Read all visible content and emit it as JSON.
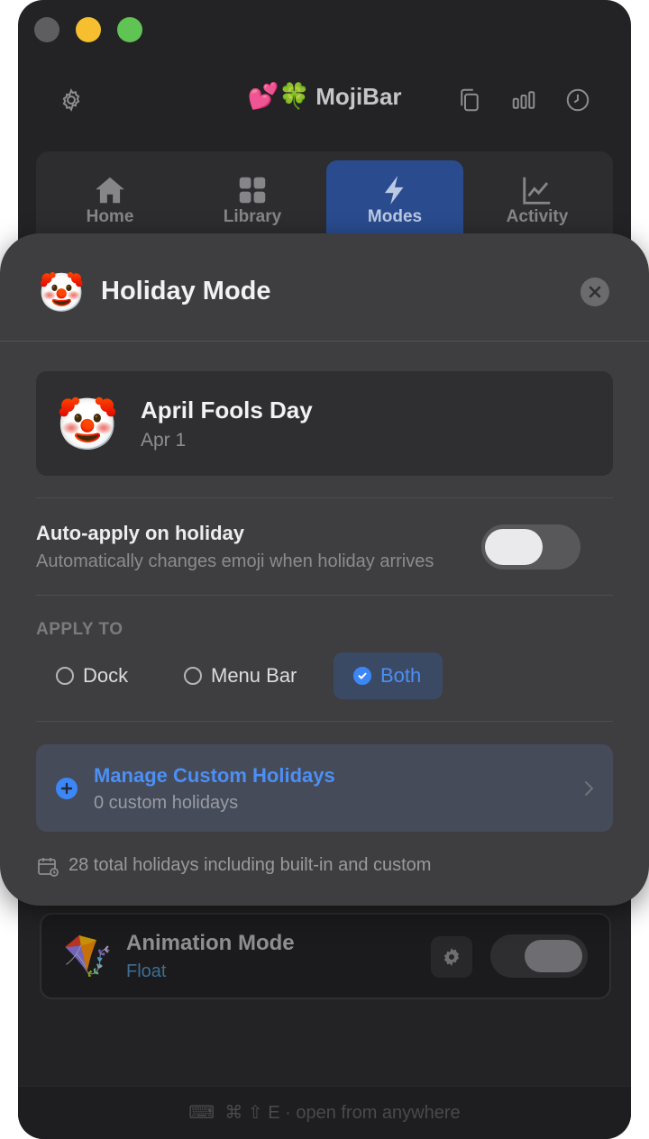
{
  "app": {
    "title": "MojiBar",
    "title_emojis": "💕🍀"
  },
  "tabs": [
    {
      "label": "Home",
      "icon": "home-icon",
      "active": false
    },
    {
      "label": "Library",
      "icon": "grid-icon",
      "active": false
    },
    {
      "label": "Modes",
      "icon": "bolt-icon",
      "active": true
    },
    {
      "label": "Activity",
      "icon": "chart-icon",
      "active": false
    }
  ],
  "modal": {
    "title": "Holiday Mode",
    "title_emoji": "🤡",
    "holiday": {
      "emoji": "🤡",
      "name": "April Fools Day",
      "date": "Apr 1"
    },
    "auto_apply": {
      "title": "Auto-apply on holiday",
      "subtitle": "Automatically changes emoji when holiday arrives",
      "enabled": false
    },
    "apply_to": {
      "label": "APPLY TO",
      "options": [
        "Dock",
        "Menu Bar",
        "Both"
      ],
      "selected": "Both"
    },
    "manage": {
      "title": "Manage Custom Holidays",
      "subtitle": "0 custom holidays"
    },
    "total_text": "28 total holidays including built-in and custom"
  },
  "animation_mode": {
    "emoji": "🪁",
    "title": "Animation Mode",
    "subtitle": "Float",
    "enabled": true
  },
  "footer": {
    "shortcut": "⌘ ⇧ E  ·  open from anywhere"
  },
  "colors": {
    "accent": "#3d86f5",
    "window_bg": "#232325",
    "modal_bg": "#3e3e40"
  }
}
